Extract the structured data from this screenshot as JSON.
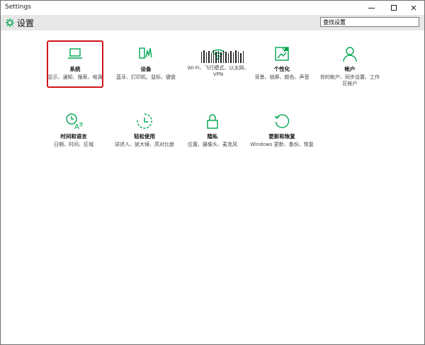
{
  "window": {
    "title": "Settings"
  },
  "header": {
    "title": "设置",
    "search_placeholder": "查找设置"
  },
  "accent": "#00a651",
  "highlight_color": "#d0161b",
  "tiles": [
    {
      "name": "系统",
      "desc": "显示、通知、搜索、电源",
      "icon": "laptop-icon"
    },
    {
      "name": "设备",
      "desc": "蓝牙、打印机、鼠标、键盘",
      "icon": "devices-icon"
    },
    {
      "name": "",
      "desc": "Wi-Fi、飞行模式、以太网、VPN",
      "icon": "network-icon"
    },
    {
      "name": "个性化",
      "desc": "背景、锁屏、颜色、声音",
      "icon": "personalization-icon"
    },
    {
      "name": "帐户",
      "desc": "你的帐户、同步设置、工作区帐户",
      "icon": "accounts-icon"
    },
    {
      "name": "时间和语言",
      "desc": "日期、时间、区域",
      "icon": "time-language-icon"
    },
    {
      "name": "轻松使用",
      "desc": "讲述人、放大镜、高对比度",
      "icon": "ease-of-access-icon"
    },
    {
      "name": "隐私",
      "desc": "位置、摄像头、麦克风",
      "icon": "privacy-icon"
    },
    {
      "name": "更新和恢复",
      "desc": "Windows 更新、备份、恢复",
      "icon": "update-recovery-icon"
    }
  ]
}
